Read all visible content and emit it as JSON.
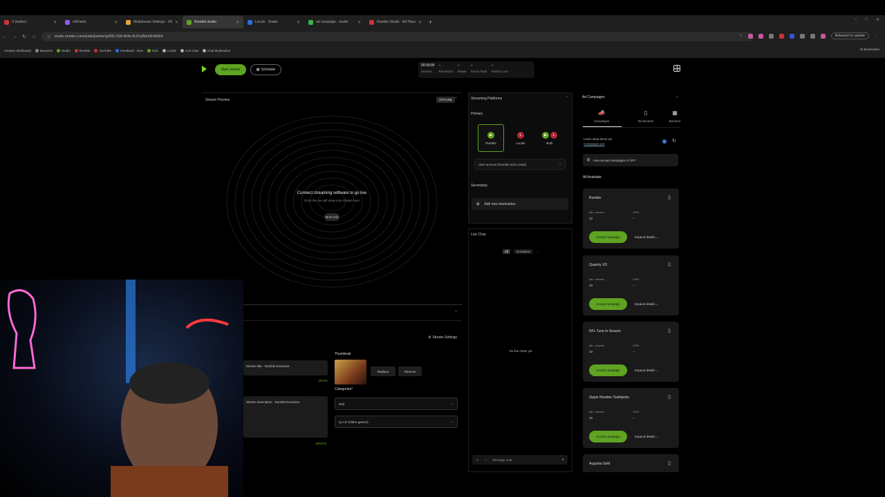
{
  "browser": {
    "tabs": [
      {
        "label": "X (twitter)",
        "active": false
      },
      {
        "label": "mitFateh",
        "active": false
      },
      {
        "label": "Multistream Settings · Ohw",
        "active": false
      },
      {
        "label": "Rumble studio",
        "active": true
      },
      {
        "label": "Locals · Studio",
        "active": false
      },
      {
        "label": "ad campaign · studio",
        "active": false
      },
      {
        "label": "Rumble Studio · Ad Placem",
        "active": false
      }
    ],
    "new_tab": "+",
    "url": "studio.rumble.com/studio/partner/g/3f5c-538-4b4e-8c2f-a0be18c4e6b9",
    "profile_label": "Relaunch to update",
    "bookmarks": [
      "creators dashboard",
      "Business",
      "Studio",
      "Rumble",
      "YouTube",
      "Facebook · Rum",
      "Kick",
      "Locals",
      "Live Chat",
      "Chat Moderation"
    ],
    "all_bookmarks": "All Bookmarks"
  },
  "header": {
    "start_label": "Start stream",
    "schedule_label": "Schedule",
    "stats": [
      {
        "value": "00:00:00",
        "label": "Session"
      },
      {
        "value": "–",
        "label": "Resolution"
      },
      {
        "value": "–",
        "label": "Bitrate"
      },
      {
        "value": "–",
        "label": "Frame Rate"
      },
      {
        "value": "–",
        "label": "Packet Loss"
      }
    ]
  },
  "preview": {
    "title": "Stream Preview",
    "status": "OFFLINE",
    "connect_title": "Connect streaming software to go live",
    "connect_sub": "Once live we will show your stream here",
    "more_label": "More info"
  },
  "details": {
    "settings_label": "Stream Settings",
    "field1_value": "Stream title · Rumble Exclusive",
    "field2_value": "Stream description · Rumble Exclusive",
    "counter1": "48/100",
    "counter2": "48/5000",
    "thumbnail_label": "Thumbnail",
    "replace_label": "Replace",
    "remove_label": "Remove",
    "categories_label": "Categories*",
    "category1": "Kick",
    "category2": "Q.A.D (Video games)"
  },
  "platforms": {
    "title": "Streaming Platforms",
    "primary_label": "Primary",
    "cards": [
      {
        "name": "Rumble",
        "icon": "rumble-icon",
        "selected": true
      },
      {
        "name": "Locals",
        "icon": "locals-icon",
        "selected": false
      },
      {
        "name": "Both",
        "icon": "both-icon",
        "selected": false
      }
    ],
    "account_select": "User account (Rumble and Locals)",
    "secondary_label": "Secondary",
    "add_destination": "Add new destination"
  },
  "chat": {
    "title": "Live Chat",
    "filter_all": "All",
    "filter_donations": "Donations",
    "empty": "No live chats yet",
    "input_placeholder": "Message chat"
  },
  "ads": {
    "title": "Ad Campaigns",
    "tabs": [
      {
        "label": "Campaigns",
        "icon": "megaphone-icon"
      },
      {
        "label": "Bookmarks",
        "icon": "bookmark-icon"
      },
      {
        "label": "Banners",
        "icon": "banner-icon"
      }
    ],
    "learn_text": "Learn what these ad",
    "learn_link": "Campaigns are",
    "search_placeholder": "Auto-accept campaigns is OFF",
    "all_available": "All Available",
    "accept_label": "Accept campaign",
    "expand_label": "Expand details",
    "cards": [
      {
        "name": "Rumble",
        "l1": "Min. viewers",
        "v1": "10",
        "l2": "CPM",
        "v2": "–"
      },
      {
        "name": "Quantry XD",
        "l1": "Min. viewers",
        "v1": "10",
        "l2": "CPM",
        "v2": "–"
      },
      {
        "name": "NFL Tune In Season",
        "l1": "Min. viewers",
        "v1": "10",
        "l2": "CPM",
        "v2": "–"
      },
      {
        "name": "Zipple Nicotine Toothpicks",
        "l1": "Min. viewers",
        "v1": "10",
        "l2": "CPM",
        "v2": "–"
      },
      {
        "name": "Augusta Gold",
        "l1": "",
        "v1": "",
        "l2": "",
        "v2": ""
      }
    ]
  },
  "colors": {
    "accent": "#5ea321",
    "panel": "#0c0c0c",
    "card": "#1a1a1a"
  }
}
